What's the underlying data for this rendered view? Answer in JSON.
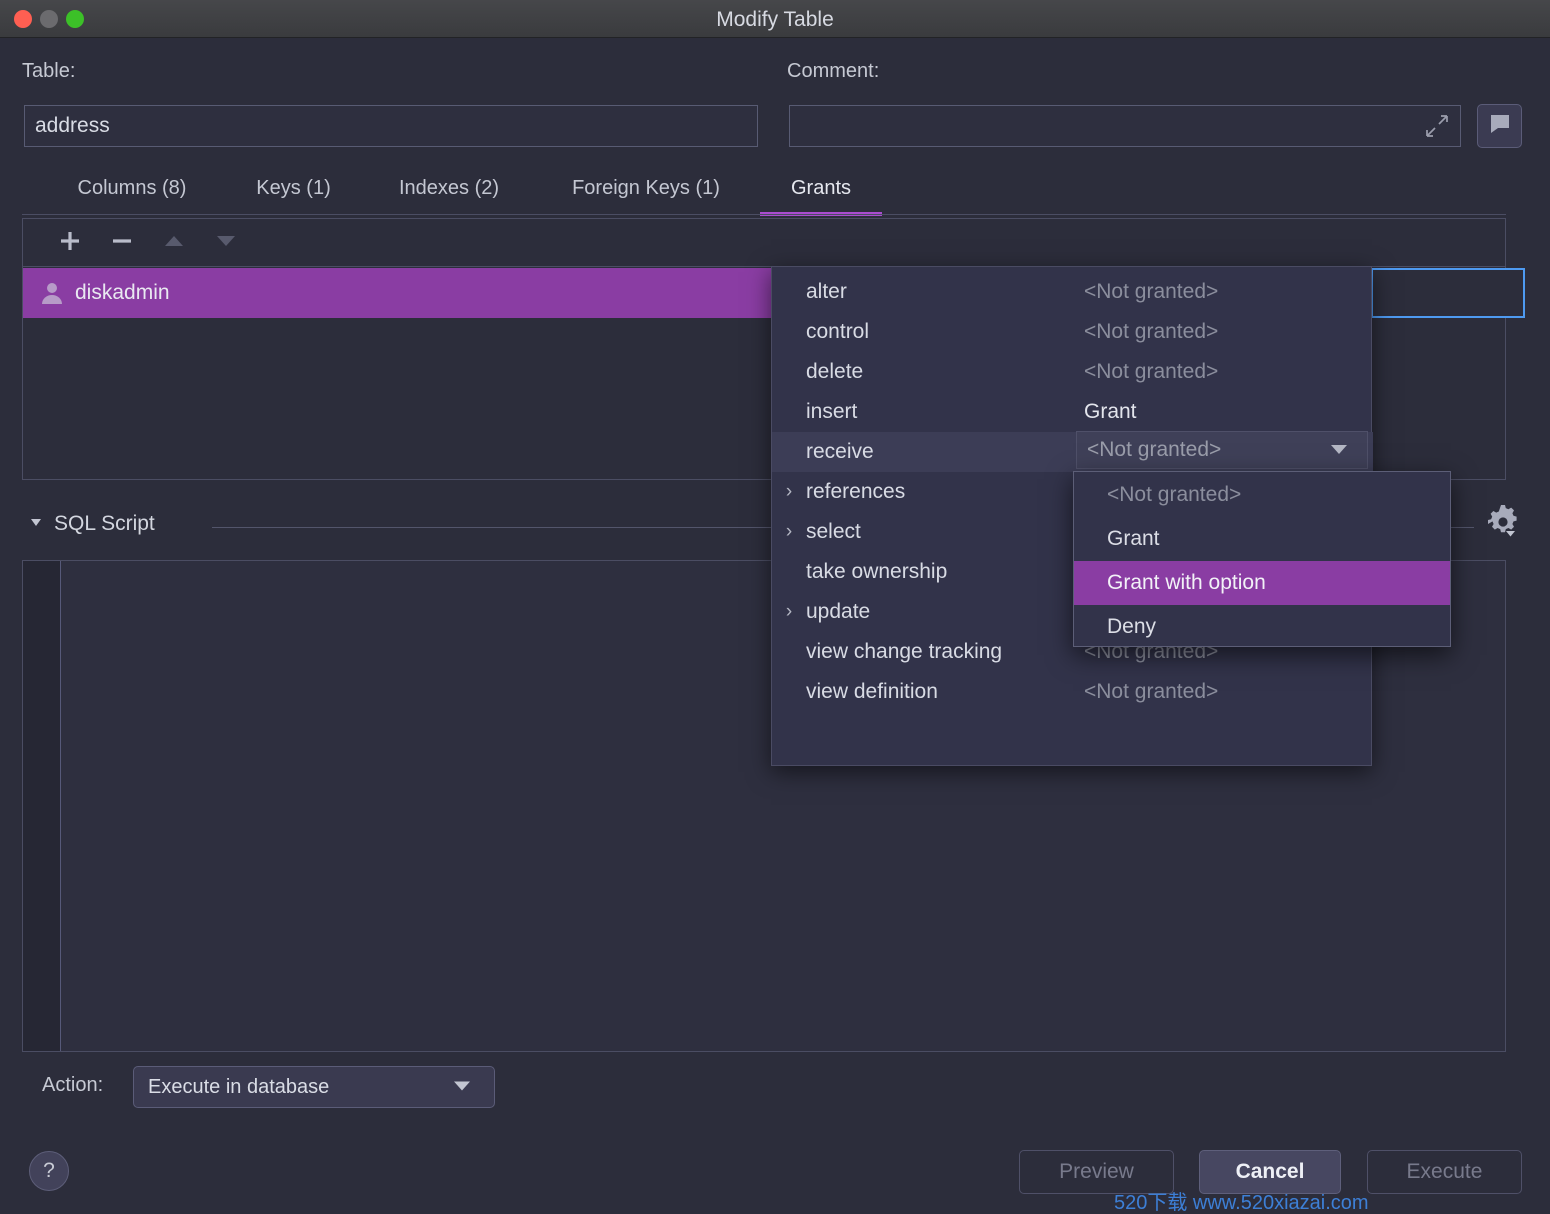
{
  "window": {
    "title": "Modify Table",
    "traffic_lights": [
      "close-button",
      "minimize-button",
      "maximize-button"
    ]
  },
  "form": {
    "table_label": "Table:",
    "table_value": "address",
    "comment_label": "Comment:",
    "comment_value": "",
    "comment_placeholder": "",
    "expand_icon": "expand-diagonal-icon",
    "comment_button_icon": "speech-bubble-icon"
  },
  "tabs": [
    {
      "label": "Columns (8)",
      "active": false
    },
    {
      "label": "Keys (1)",
      "active": false
    },
    {
      "label": "Indexes (2)",
      "active": false
    },
    {
      "label": "Foreign Keys (1)",
      "active": false
    },
    {
      "label": "Grants",
      "active": true
    }
  ],
  "grants_toolbar": [
    {
      "name": "add-button",
      "icon": "plus-icon",
      "enabled": true
    },
    {
      "name": "remove-button",
      "icon": "minus-icon",
      "enabled": true
    },
    {
      "name": "move-up-button",
      "icon": "triangle-up-icon",
      "enabled": false
    },
    {
      "name": "move-down-button",
      "icon": "triangle-down-icon",
      "enabled": false
    }
  ],
  "grants_rows": [
    {
      "icon": "user-icon",
      "grantee": "diskadmin",
      "selected": true
    }
  ],
  "permissions_popup": [
    {
      "name": "alter",
      "value": "<Not granted>",
      "expandable": false,
      "granted": false,
      "highlighted": false
    },
    {
      "name": "control",
      "value": "<Not granted>",
      "expandable": false,
      "granted": false,
      "highlighted": false
    },
    {
      "name": "delete",
      "value": "<Not granted>",
      "expandable": false,
      "granted": false,
      "highlighted": false
    },
    {
      "name": "insert",
      "value": "Grant",
      "expandable": false,
      "granted": true,
      "highlighted": false
    },
    {
      "name": "receive",
      "value": "<Not granted>",
      "expandable": false,
      "granted": false,
      "highlighted": true
    },
    {
      "name": "references",
      "value": "",
      "expandable": true,
      "granted": false,
      "highlighted": false
    },
    {
      "name": "select",
      "value": "",
      "expandable": true,
      "granted": false,
      "highlighted": false
    },
    {
      "name": "take ownership",
      "value": "",
      "expandable": false,
      "granted": false,
      "highlighted": false
    },
    {
      "name": "update",
      "value": "",
      "expandable": true,
      "granted": false,
      "highlighted": false
    },
    {
      "name": "view change tracking",
      "value": "<Not granted>",
      "expandable": false,
      "granted": false,
      "highlighted": false
    },
    {
      "name": "view definition",
      "value": "<Not granted>",
      "expandable": false,
      "granted": false,
      "highlighted": false
    }
  ],
  "permission_combo": {
    "value": "<Not granted>",
    "caret_icon": "caret-down-icon"
  },
  "grant_dropdown": {
    "options": [
      {
        "label": "<Not granted>",
        "selected": false,
        "dim": true
      },
      {
        "label": "Grant",
        "selected": false,
        "dim": false
      },
      {
        "label": "Grant with option",
        "selected": true,
        "dim": false
      },
      {
        "label": "Deny",
        "selected": false,
        "dim": false
      }
    ]
  },
  "sql_script": {
    "section_label": "SQL Script",
    "collapse_icon": "triangle-down-icon",
    "settings_icon": "gear-icon",
    "content": ""
  },
  "bottom": {
    "action_label": "Action:",
    "action_value": "Execute in database",
    "action_caret_icon": "caret-down-icon",
    "help_label": "?",
    "preview_label": "Preview",
    "cancel_label": "Cancel",
    "execute_label": "Execute"
  },
  "watermark": "520下载 www.520xiazai.com",
  "colors": {
    "accent_purple": "#8a3da3",
    "tab_underline": "#a94ccf",
    "focus_blue": "#4e9af1",
    "panel_bg": "#2c2d3b",
    "field_bg": "#2e2f3f",
    "popup_bg": "#32334a",
    "watermark_blue": "#3d7fd6"
  }
}
